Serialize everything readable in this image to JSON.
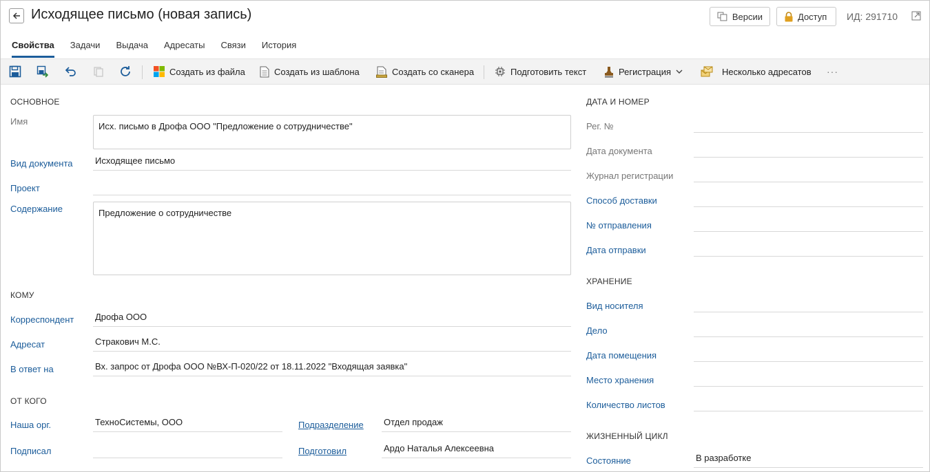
{
  "header": {
    "title": "Исходящее письмо (новая запись)",
    "versions_label": "Версии",
    "access_label": "Доступ",
    "id_label": "ИД:",
    "id_value": "291710"
  },
  "tabs": [
    {
      "label": "Свойства",
      "active": true
    },
    {
      "label": "Задачи"
    },
    {
      "label": "Выдача"
    },
    {
      "label": "Адресаты"
    },
    {
      "label": "Связи"
    },
    {
      "label": "История"
    }
  ],
  "toolbar": {
    "create_from_file": "Создать из файла",
    "create_from_template": "Создать из шаблона",
    "create_from_scanner": "Создать со сканера",
    "prepare_text": "Подготовить текст",
    "registration": "Регистрация",
    "multiple_recipients": "Несколько адресатов",
    "more": "···"
  },
  "main": {
    "section": "ОСНОВНОЕ",
    "name_label": "Имя",
    "name_value": "Исх. письмо в Дрофа ООО \"Предложение о сотрудничестве\"",
    "doc_type_label": "Вид документа",
    "doc_type_value": "Исходящее письмо",
    "project_label": "Проект",
    "project_value": "",
    "content_label": "Содержание",
    "content_value": "Предложение о сотрудничестве"
  },
  "to": {
    "section": "КОМУ",
    "correspondent_label": "Корреспондент",
    "correspondent_value": "Дрофа ООО",
    "addressee_label": "Адресат",
    "addressee_value": "Стракович М.С.",
    "reply_to_label": "В ответ на",
    "reply_to_value": "Вх. запрос от Дрофа ООО №ВХ-П-020/22 от 18.11.2022 \"Входящая заявка\""
  },
  "from": {
    "section": "ОТ КОГО",
    "our_org_label": "Наша орг.",
    "our_org_value": "ТехноСистемы, ООО",
    "department_label": "Подразделение",
    "department_value": "Отдел продаж",
    "signed_label": "Подписал",
    "signed_value": "",
    "prepared_label": "Подготовил",
    "prepared_value": "Ардо Наталья Алексеевна"
  },
  "date_number": {
    "section": "ДАТА И НОМЕР",
    "reg_no_label": "Рег. №",
    "doc_date_label": "Дата документа",
    "reg_journal_label": "Журнал регистрации",
    "delivery_method_label": "Способ доставки",
    "dispatch_no_label": "№ отправления",
    "dispatch_date_label": "Дата отправки"
  },
  "storage": {
    "section": "ХРАНЕНИЕ",
    "media_type_label": "Вид носителя",
    "case_label": "Дело",
    "placement_date_label": "Дата помещения",
    "location_label": "Место хранения",
    "sheets_label": "Количество листов"
  },
  "lifecycle": {
    "section": "ЖИЗНЕННЫЙ ЦИКЛ",
    "state_label": "Состояние",
    "state_value": "В разработке"
  }
}
